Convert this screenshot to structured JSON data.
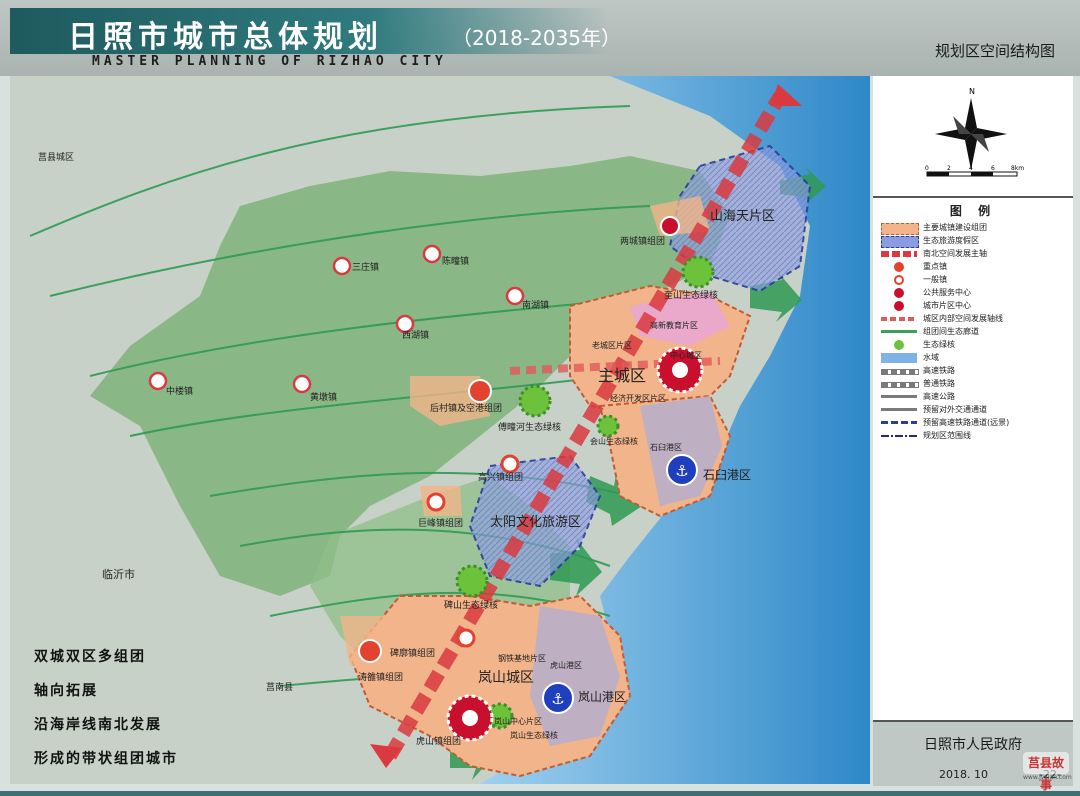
{
  "header": {
    "title": "日照市城市总体规划",
    "years": "（2018-2035年）",
    "english_title": "MASTER PLANNING OF RIZHAO CITY",
    "map_name": "规划区空间结构图"
  },
  "map": {
    "districts": {
      "main_city": "主城区",
      "shanhai": "山海天片区",
      "taiyang": "太阳文化旅游区",
      "lanshan": "岚山城区",
      "shijiu_port": "石臼港区",
      "lanshan_port": "岚山港区"
    },
    "areas": {
      "gaoxin": "高新教育片区",
      "laocheng": "老城区片区",
      "center": "中心城区",
      "jingji": "经济开发区片区",
      "shijiu": "石臼港区",
      "gangqu": "钢铁基地片区",
      "lanshan_center": "岚山中心片区",
      "hanhaihe": "虎山港区"
    },
    "clusters": {
      "tao_luo": "涛雒镇组团",
      "houcun": "后村镇及空港组团",
      "gaoxing": "高兴镇组团",
      "jufeng": "巨峰镇组团",
      "shanhai_group": "两城镇组团",
      "xiaohe": "碑廓镇组团",
      "huashan": "虎山镇组团"
    },
    "eco_cores": {
      "kuishan": "奎山生态绿核",
      "fujinghe": "傅疃河生态绿核",
      "anshan": "会山生态绿核",
      "guoshan": "碑山生态绿核",
      "lanshanhe": "岚山生态绿核"
    },
    "towns": {
      "sanzhuang": "三庄镇",
      "chenzhuang": "陈疃镇",
      "nanhu": "南湖镇",
      "xihu": "西湖镇",
      "zhonglou": "中楼镇",
      "huangdun": "黄墩镇"
    },
    "places": {
      "juxian": "莒县城区",
      "linyi": "临沂市",
      "junan": "莒南县"
    }
  },
  "compass": {
    "north": "N",
    "scale_ticks": [
      "0",
      "2",
      "4",
      "6",
      "8km"
    ]
  },
  "legend": {
    "title": "图  例",
    "items": [
      {
        "label": "主要城镇建设组团",
        "color": "#f2b48a"
      },
      {
        "label": "生态旅游度假区",
        "color": "#8a9ce0"
      },
      {
        "label": "南北空间发展主轴",
        "color": "#d9393f"
      },
      {
        "label": "重点镇",
        "color": "#e3422f"
      },
      {
        "label": "一般镇",
        "color": "#e3422f"
      },
      {
        "label": "公共服务中心",
        "color": "#c8102e"
      },
      {
        "label": "城市片区中心",
        "color": "#c8102e"
      },
      {
        "label": "城区内部空间发展轴线",
        "color": "#e05a5a"
      },
      {
        "label": "组团间生态廊道",
        "color": "#3aa05a"
      },
      {
        "label": "生态绿核",
        "color": "#6cc23a"
      },
      {
        "label": "水域",
        "color": "#7fb2e6"
      },
      {
        "label": "高速铁路",
        "color": "#7a7a7a"
      },
      {
        "label": "普通铁路",
        "color": "#7a7a7a"
      },
      {
        "label": "高速公路",
        "color": "#7a7a7a"
      },
      {
        "label": "预留对外交通通道",
        "color": "#7a7a7a"
      },
      {
        "label": "预留高速铁路通道(远景)",
        "color": "#2a3d9c"
      },
      {
        "label": "规划区范围线",
        "color": "#2a2a6a"
      }
    ]
  },
  "slogans": [
    "双城双区多组团",
    "轴向拓展",
    "沿海岸线南北发展",
    "形成的带状组团城市"
  ],
  "footer": {
    "government": "日照市人民政府",
    "date": "2018. 10",
    "page": "-22-",
    "watermark": "莒县故事",
    "watermark_url": "www.jvxian.com"
  },
  "colors": {
    "sea": "#3f9ed6",
    "land": "#c7d2c7",
    "planning_green": "#7fb37a",
    "urban": "#f2b48a",
    "axis": "#d9393f",
    "corridor": "#2e9a52",
    "header_band": "#1e5a5e"
  }
}
